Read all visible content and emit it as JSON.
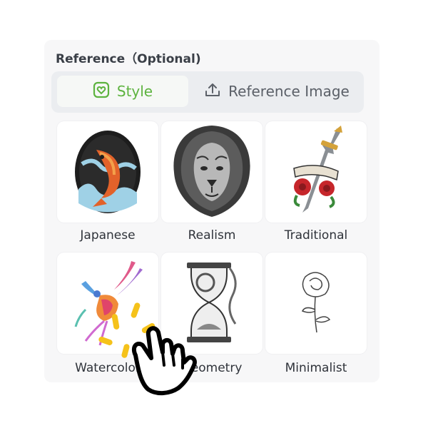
{
  "section": {
    "title": "Reference（Optional)"
  },
  "tabs": [
    {
      "label": "Style",
      "icon": "heart-square-icon",
      "active": true
    },
    {
      "label": "Reference Image",
      "icon": "upload-icon",
      "active": false
    }
  ],
  "styles": [
    {
      "label": "Japanese",
      "image": "koi-fish-tattoo"
    },
    {
      "label": "Realism",
      "image": "lion-tattoo"
    },
    {
      "label": "Traditional",
      "image": "dagger-tattoo"
    },
    {
      "label": "Watercolor",
      "image": "phoenix-tattoo"
    },
    {
      "label": "Geometry",
      "image": "hourglass-tattoo"
    },
    {
      "label": "Minimalist",
      "image": "rose-tattoo"
    }
  ],
  "colors": {
    "accent": "#5db33f",
    "panel": "#f7f7f8",
    "tab_bar": "#ebedf0",
    "cursor_sparks": "#f5c21a"
  },
  "cursor": {
    "icon": "pointing-hand-cursor-icon"
  }
}
